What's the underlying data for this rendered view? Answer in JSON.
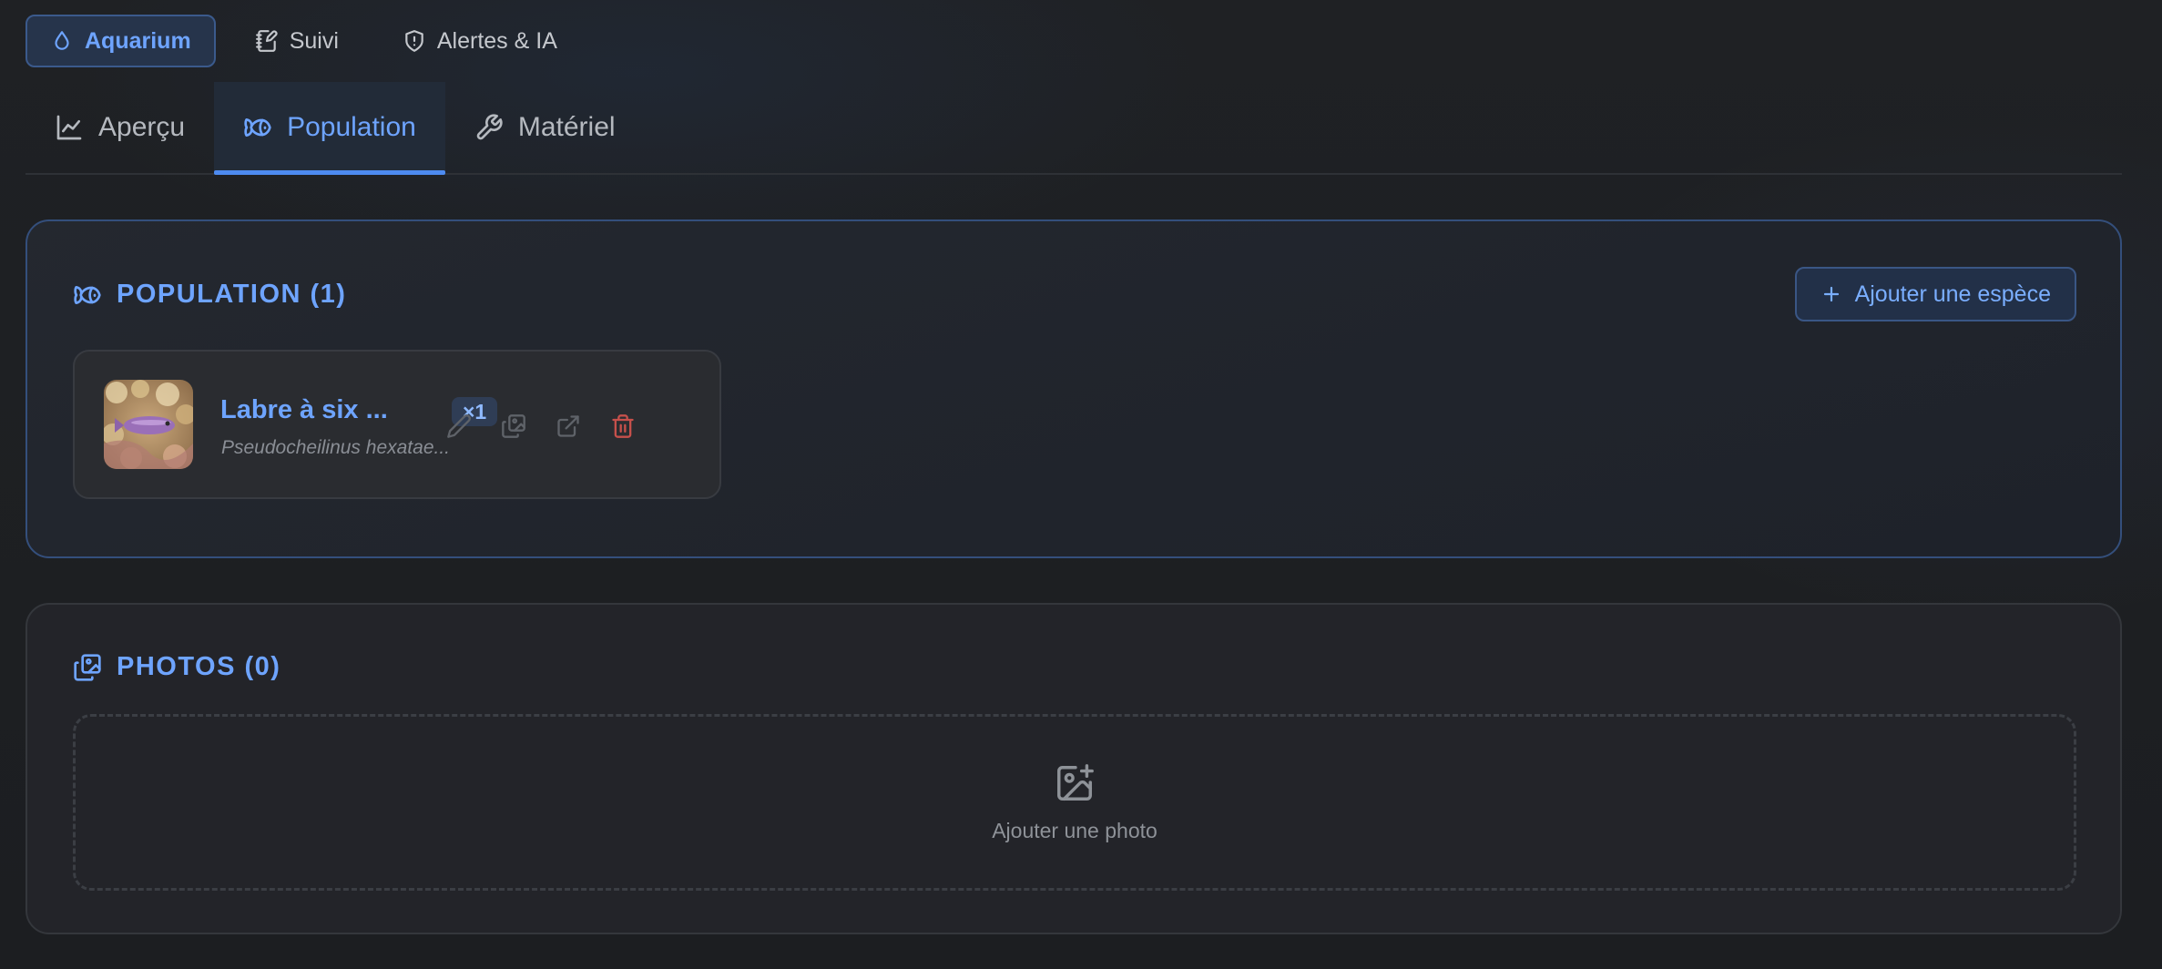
{
  "top_nav": {
    "items": [
      {
        "label": "Aquarium",
        "icon": "droplet-icon",
        "active": true
      },
      {
        "label": "Suivi",
        "icon": "notebook-pen-icon",
        "active": false
      },
      {
        "label": "Alertes & IA",
        "icon": "shield-alert-icon",
        "active": false
      }
    ]
  },
  "sub_tabs": {
    "items": [
      {
        "label": "Aperçu",
        "icon": "chart-line-icon",
        "active": false
      },
      {
        "label": "Population",
        "icon": "fish-icon",
        "active": true
      },
      {
        "label": "Matériel",
        "icon": "wrench-icon",
        "active": false
      }
    ]
  },
  "population": {
    "title": "POPULATION (1)",
    "add_button": "Ajouter une espèce",
    "species": [
      {
        "name": "Labre à six ...",
        "count": "×1",
        "scientific": "Pseudocheilinus hexatae..."
      }
    ]
  },
  "photos": {
    "title": "PHOTOS (0)",
    "add_label": "Ajouter une photo"
  },
  "colors": {
    "accent": "#6ea4ff",
    "danger": "#d9534f",
    "background": "#1d1f22"
  }
}
